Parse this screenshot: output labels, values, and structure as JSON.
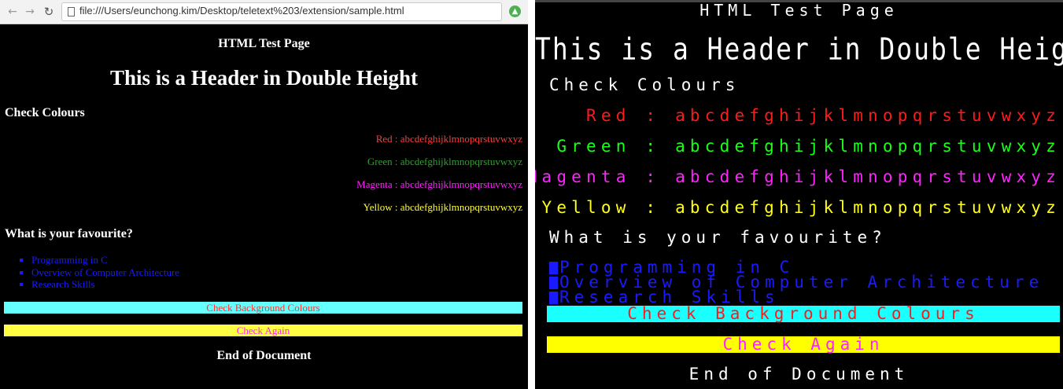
{
  "browser": {
    "back_icon": "←",
    "forward_icon": "→",
    "reload_icon": "↻",
    "url": "file:///Users/eunchong.kim/Desktop/teletext%203/extension/sample.html",
    "extension_icon": "▲"
  },
  "page": {
    "title": "HTML Test Page",
    "header": "This is a Header in Double Height",
    "check_colours": "Check Colours",
    "colors": {
      "red": "Red : abcdefghijklmnopqrstuvwxyz",
      "green": "Green : abcdefghijklmnopqrstuvwxyz",
      "magenta": "Magenta : abcdefghijklmnopqrstuvwxyz",
      "yellow": "Yellow : abcdefghijklmnopqrstuvwxyz"
    },
    "question": "What is your favourite?",
    "items": [
      "Programming in C",
      "Overview of Computer Architecture",
      "Research Skills"
    ],
    "bg_check_1": "Check Background Colours",
    "bg_check_2": "Check Again",
    "end": "End of Document"
  },
  "teletext": {
    "title": "HTML Test Page",
    "header": "This is a Header in Double Height",
    "check_colours": "Check Colours",
    "colors": {
      "red": "Red : abcdefghijklmnopqrstuvwxyz",
      "green": "Green : abcdefghijklmnopqrstuvwxyz",
      "magenta": "Magenta : abcdefghijklmnopqrstuvwxyz",
      "yellow": "Yellow : abcdefghijklmnopqrstuvwxyz"
    },
    "question": "What is your favourite?",
    "items": [
      "Programming in C",
      "Overview of Computer Architecture",
      "Research Skills"
    ],
    "bg_check_1": "Check Background Colours",
    "bg_check_2": "Check Again",
    "end": "End of Document"
  },
  "colors": {
    "red": "#ff3b3b",
    "green": "#2ea02e",
    "magenta": "#ff22ff",
    "yellow": "#ffff33",
    "cyan_bg": "#66ffff",
    "list_blue": "#1a1aff"
  }
}
